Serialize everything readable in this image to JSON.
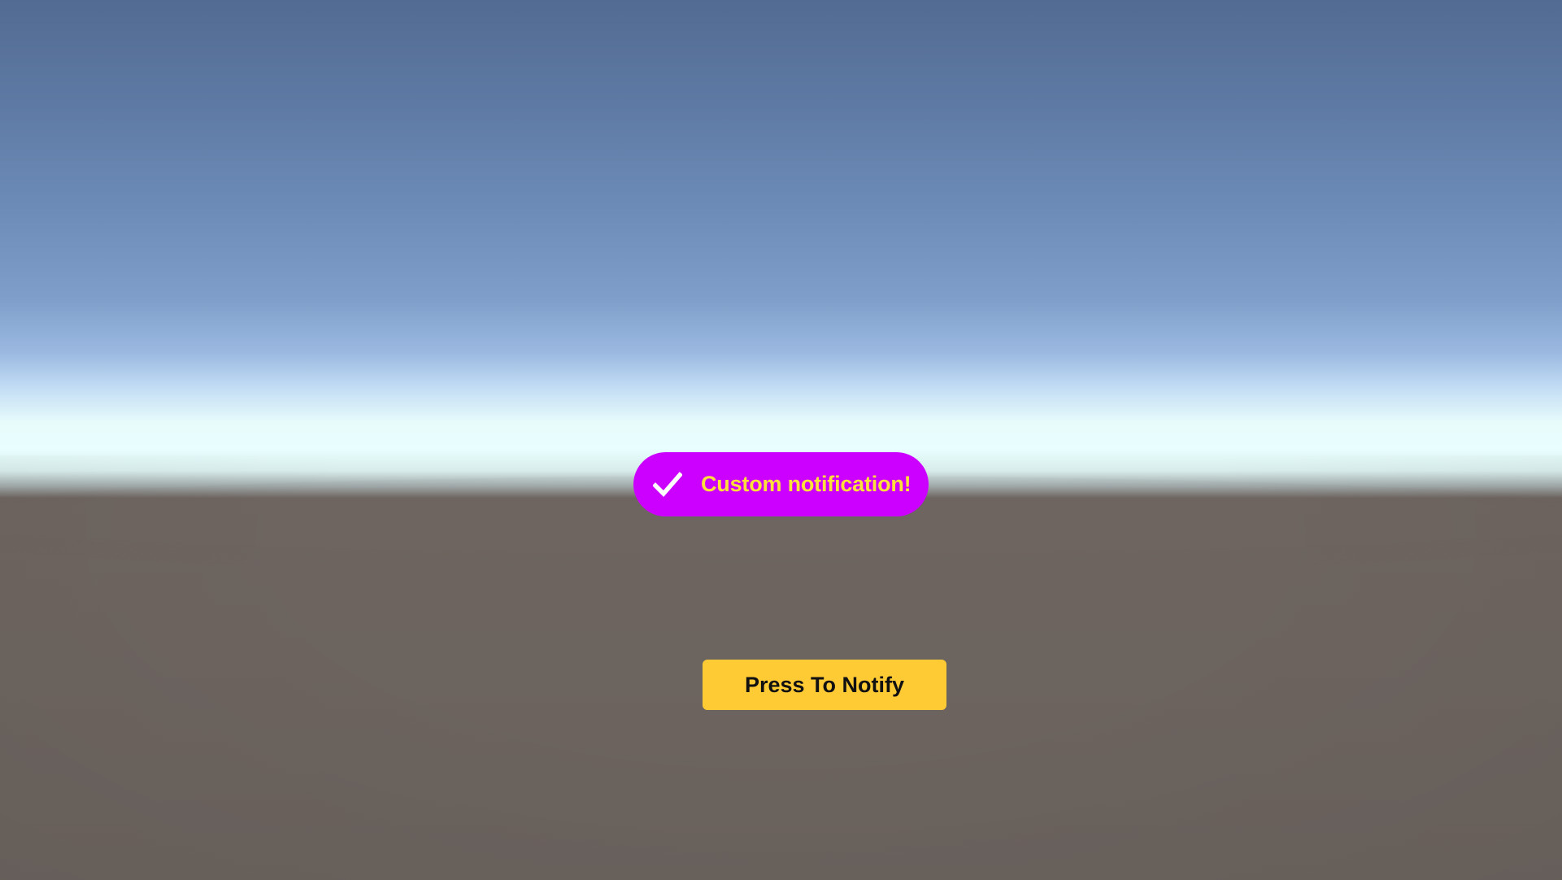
{
  "notification": {
    "text": "Custom notification!",
    "icon": "checkmark-icon",
    "background_color": "#cc00ff",
    "text_color": "#ffe03a",
    "icon_color": "#ffffff"
  },
  "button": {
    "label": "Press To Notify",
    "background_color": "#ffcb35",
    "text_color": "#111111"
  },
  "scene": {
    "sky_top_color": "#526b92",
    "horizon_color": "#e9ffff",
    "ground_color": "#6a625d"
  }
}
